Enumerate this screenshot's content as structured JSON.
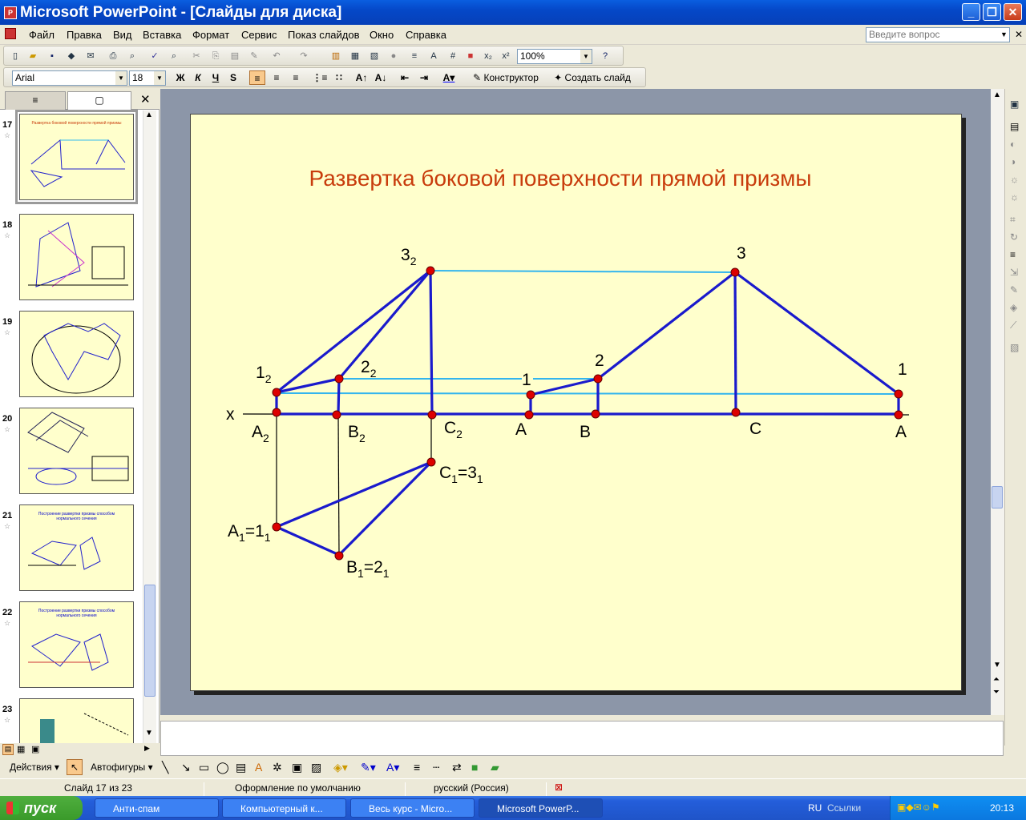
{
  "window": {
    "title": "Microsoft PowerPoint - [Слайды для диска]",
    "app_icon": "powerpoint-icon"
  },
  "menu": {
    "items": [
      "Файл",
      "Правка",
      "Вид",
      "Вставка",
      "Формат",
      "Сервис",
      "Показ слайдов",
      "Окно",
      "Справка"
    ],
    "ask_placeholder": "Введите вопрос"
  },
  "standard_toolbar": {
    "zoom": "100%"
  },
  "formatting_toolbar": {
    "font": "Arial",
    "size": "18",
    "bold": "Ж",
    "italic": "К",
    "underline": "Ч",
    "shadow": "S",
    "designer": "Конструктор",
    "new_slide": "Создать слайд"
  },
  "thumbnails": [
    {
      "num": "17",
      "title": "Развертка боковой поверхности прямой призмы",
      "selected": true
    },
    {
      "num": "18",
      "title": ""
    },
    {
      "num": "19",
      "title": ""
    },
    {
      "num": "20",
      "title": ""
    },
    {
      "num": "21",
      "title": "Построение развертки призмы способом нормального сечения"
    },
    {
      "num": "22",
      "title": "Построение развертки призмы способом нормального сечения"
    },
    {
      "num": "23",
      "title": ""
    }
  ],
  "slide": {
    "title": "Развертка боковой поверхности прямой призмы",
    "title_color": "#c83c0c",
    "labels": {
      "x": "x",
      "p32": "3",
      "p32s": "2",
      "p3": "3",
      "p12": "1",
      "p12s": "2",
      "p22": "2",
      "p22s": "2",
      "p1a": "1",
      "p2": "2",
      "p1b": "1",
      "A2": "A",
      "A2s": "2",
      "B2": "B",
      "B2s": "2",
      "C2": "C",
      "C2s": "2",
      "Aa": "A",
      "Bb": "B",
      "Cc": "C",
      "Ab": "A",
      "C1": "C",
      "C1s": "1",
      "C1eq": "=3",
      "C1s2": "1",
      "A1": "A",
      "A1s": "1",
      "A1eq": "=1",
      "A1s2": "1",
      "B1": "B",
      "B1s": "1",
      "B1eq": "=2",
      "B1s2": "1"
    },
    "colors": {
      "line": "#1a1acc",
      "helper": "#33b5ee",
      "point": "#dd0000"
    }
  },
  "drawing_toolbar": {
    "actions": "Действия",
    "autoshapes": "Автофигуры"
  },
  "status": {
    "slide": "Слайд 17 из 23",
    "design": "Оформление по умолчанию",
    "language": "русский (Россия)"
  },
  "taskbar": {
    "start": "пуск",
    "buttons": [
      "Анти-спам",
      "Компьютерный к...",
      "Весь курс - Micro...",
      "Microsoft PowerP..."
    ],
    "lang": "RU",
    "links": "Ссылки",
    "time": "20:13"
  }
}
